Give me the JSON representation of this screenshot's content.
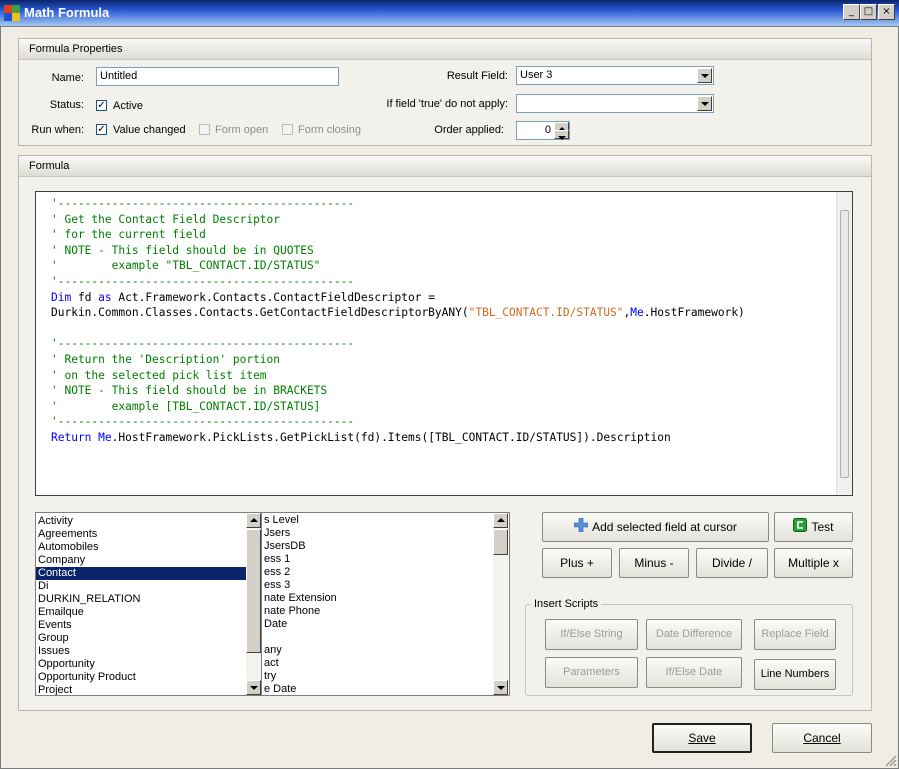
{
  "window": {
    "title": "Math Formula"
  },
  "properties": {
    "header": "Formula Properties",
    "name_label": "Name:",
    "name_value": "Untitled",
    "status_label": "Status:",
    "active_label": "Active",
    "run_when_label": "Run when:",
    "value_changed_label": "Value changed",
    "form_open_label": "Form open",
    "form_closing_label": "Form closing",
    "result_field_label": "Result Field:",
    "result_field_value": "User 3",
    "if_true_label": "If field 'true' do not apply:",
    "if_true_value": "",
    "order_label": "Order applied:",
    "order_value": "0"
  },
  "formula": {
    "header": "Formula",
    "lines": [
      "'--------------------------------------------",
      "' Get the Contact Field Descriptor",
      "' for the current field",
      "' NOTE - This field should be in QUOTES",
      "'        example \"TBL_CONTACT.ID/STATUS\"",
      "'--------------------------------------------",
      "Dim",
      " fd ",
      "as",
      " Act.Framework.Contacts.ContactFieldDescriptor =",
      "Durkin.Common.Classes.Contacts.GetContactFieldDescriptorByANY(",
      "\"TBL_CONTACT.ID/STATUS\"",
      ",",
      "Me",
      ".HostFramework)",
      "",
      "'--------------------------------------------",
      "' Return the 'Description' portion",
      "' on the selected pick list item",
      "' NOTE - This field should be in BRACKETS",
      "'        example [TBL_CONTACT.ID/STATUS]",
      "'--------------------------------------------",
      "Return",
      " ",
      "Me",
      ".HostFramework.PickLists.GetPickList(fd).Items([TBL_CONTACT.ID/STATUS]).Description"
    ]
  },
  "tables": [
    "Activity",
    "Agreements",
    "Automobiles",
    "Company",
    "Contact",
    "Di",
    "DURKIN_RELATION",
    "Emailque",
    "Events",
    "Group",
    "Issues",
    "Opportunity",
    "Opportunity Product",
    "Project"
  ],
  "fields": [
    "s Level",
    "Jsers",
    "JsersDB",
    "ess 1",
    "ess 2",
    "ess 3",
    "nate Extension",
    "nate Phone",
    "Date",
    "",
    "any",
    "act",
    "try",
    "e Date"
  ],
  "buttons": {
    "add_field": "Add selected field at cursor",
    "test": "Test",
    "plus": "Plus +",
    "minus": "Minus -",
    "divide": "Divide /",
    "multiple": "Multiple x"
  },
  "scripts": {
    "header": "Insert Scripts",
    "if_else_string": "If/Else String",
    "date_difference": "Date Difference",
    "replace_field": "Replace Field",
    "parameters": "Parameters",
    "if_else_date": "If/Else Date",
    "line_numbers": "Line Numbers"
  },
  "footer": {
    "save": "Save",
    "cancel": "Cancel"
  }
}
